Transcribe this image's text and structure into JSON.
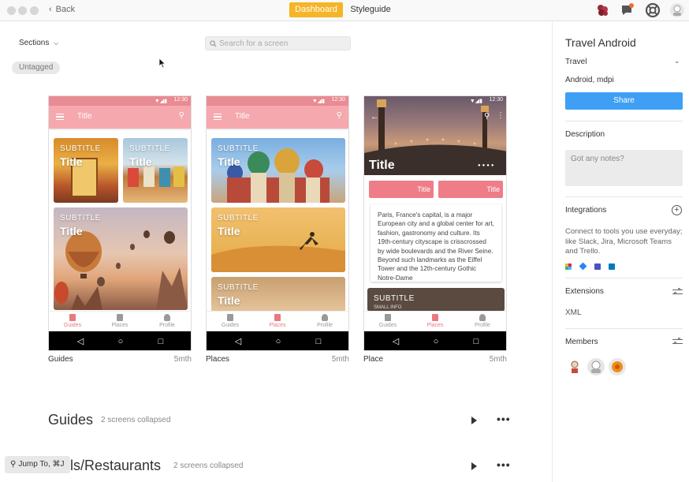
{
  "topbar": {
    "back_label": "Back",
    "tabs": [
      {
        "label": "Dashboard",
        "active": true
      },
      {
        "label": "Styleguide",
        "active": false
      }
    ]
  },
  "toolbar": {
    "sections_label": "Sections",
    "search_placeholder": "Search for a screen",
    "tag_label": "Untagged"
  },
  "screens": [
    {
      "name": "Guides",
      "age": "5mth",
      "appbar_title": "Title",
      "time": "12:30",
      "cards": [
        {
          "subtitle": "SUBTITLE",
          "title": "Title"
        },
        {
          "subtitle": "SUBTITLE",
          "title": "Title"
        },
        {
          "subtitle": "SUBTITLE",
          "title": "Title"
        }
      ],
      "nav": [
        "Guides",
        "Places",
        "Profile"
      ],
      "active_nav": "Guides"
    },
    {
      "name": "Places",
      "age": "5mth",
      "appbar_title": "Title",
      "time": "12:30",
      "cards": [
        {
          "subtitle": "SUBTITLE",
          "title": "Title"
        },
        {
          "subtitle": "SUBTITLE",
          "title": "Title"
        },
        {
          "subtitle": "SUBTITLE",
          "title": "Title"
        }
      ],
      "nav": [
        "Guides",
        "Places",
        "Profile"
      ],
      "active_nav": "Places"
    },
    {
      "name": "Place",
      "age": "5mth",
      "hero_title": "Title",
      "time": "12:30",
      "buttons": [
        "Title",
        "Title"
      ],
      "description": "Paris, France's capital, is a major European city and a global center for art, fashion, gastronomy and culture. Its 19th-century cityscape is crisscrossed by wide boulevards and the River Seine. Beyond such landmarks as the Eiffel Tower and the 12th-century Gothic Notre-Dame",
      "card_subtitle": "SUBTITLE",
      "card_mini": "SMALL INFO",
      "nav": [
        "Guides",
        "Places",
        "Profile"
      ],
      "active_nav": "Places"
    }
  ],
  "groups": [
    {
      "title": "Guides",
      "info": "2 screens collapsed"
    },
    {
      "title": "Hotels/Restaurants",
      "title_visible": "els/Restaurants",
      "info": "2 screens collapsed"
    }
  ],
  "jump_label": "Jump To, ⌘J",
  "right_panel": {
    "project_title": "Travel Android",
    "category": "Travel",
    "platform": "Android, mdpi",
    "share_label": "Share",
    "description_label": "Description",
    "notes_placeholder": "Got any notes?",
    "integrations_label": "Integrations",
    "integrations_desc": "Connect to tools you use everyday; like Slack, Jira, Microsoft Teams and Trello.",
    "integration_icons": [
      "slack-icon",
      "jira-icon",
      "teams-icon",
      "trello-icon"
    ],
    "extensions_label": "Extensions",
    "extensions_value": "XML",
    "members_label": "Members"
  },
  "colors": {
    "accent": "#f5b526",
    "share": "#3f9ff5",
    "app_pink": "#f5a8ae",
    "app_status": "#e98b93",
    "nav_active": "#e8797f"
  }
}
